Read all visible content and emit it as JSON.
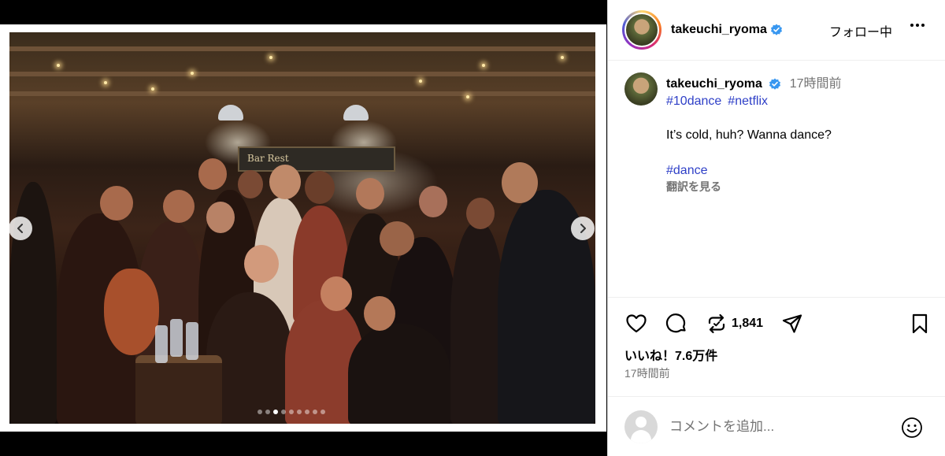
{
  "post": {
    "username": "takeuchi_ryoma",
    "follow_status": "フォロー中",
    "caption": {
      "username": "takeuchi_ryoma",
      "time_ago": "17時間前",
      "hashtags": [
        "#10dance",
        "#netflix"
      ],
      "text": "It’s cold, huh? Wanna dance?",
      "tag": "#dance",
      "translate_label": "翻訳を見る"
    },
    "repost_count": "1,841",
    "likes": "いいね！7.6万件",
    "timestamp": "17時間前",
    "comment_placeholder": "コメントを追加..."
  },
  "media": {
    "photo_sign_text": "Bar  Rest",
    "carousel": {
      "total": 9,
      "active_index": 2
    }
  },
  "icons": {
    "like": "heart-icon",
    "comment": "comment-bubble-icon",
    "repost": "repost-icon",
    "share": "paper-plane-icon",
    "save": "bookmark-icon",
    "emoji": "emoji-smile-icon",
    "verified": "verified-badge-icon",
    "more": "more-horizontal-icon"
  },
  "colors": {
    "hashtag": "#2e3fc7",
    "verified": "#3897f0",
    "muted_text": "#737373"
  }
}
